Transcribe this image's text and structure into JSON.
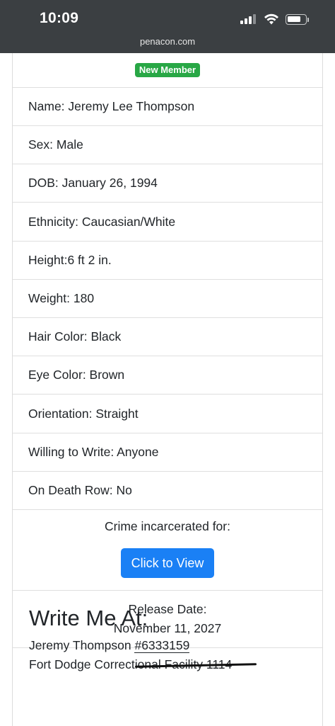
{
  "status_bar": {
    "time": "10:09",
    "url": "penacon.com"
  },
  "profile": {
    "badge": "New Member",
    "fields": [
      "Name: Jeremy Lee Thompson",
      "Sex: Male",
      "DOB: January 26, 1994",
      "Ethnicity: Caucasian/White",
      "Height:6 ft 2 in.",
      "Weight: 180",
      "Hair Color: Black",
      "Eye Color: Brown",
      "Orientation: Straight",
      "Willing to Write: Anyone",
      "On Death Row: No"
    ],
    "crime_label": "Crime incarcerated for:",
    "crime_button": "Click to View",
    "release_label": "Release Date:",
    "release_date": "November 11, 2027"
  },
  "write_me": {
    "title": "Write Me At:",
    "name": "Jeremy Thompson ",
    "inmate_number": "#6333159",
    "facility": "Fort Dodge Correctional Facility 1114"
  },
  "colors": {
    "status_bar_bg": "#3b3f42",
    "badge": "#28a745",
    "button": "#1a80f5"
  }
}
